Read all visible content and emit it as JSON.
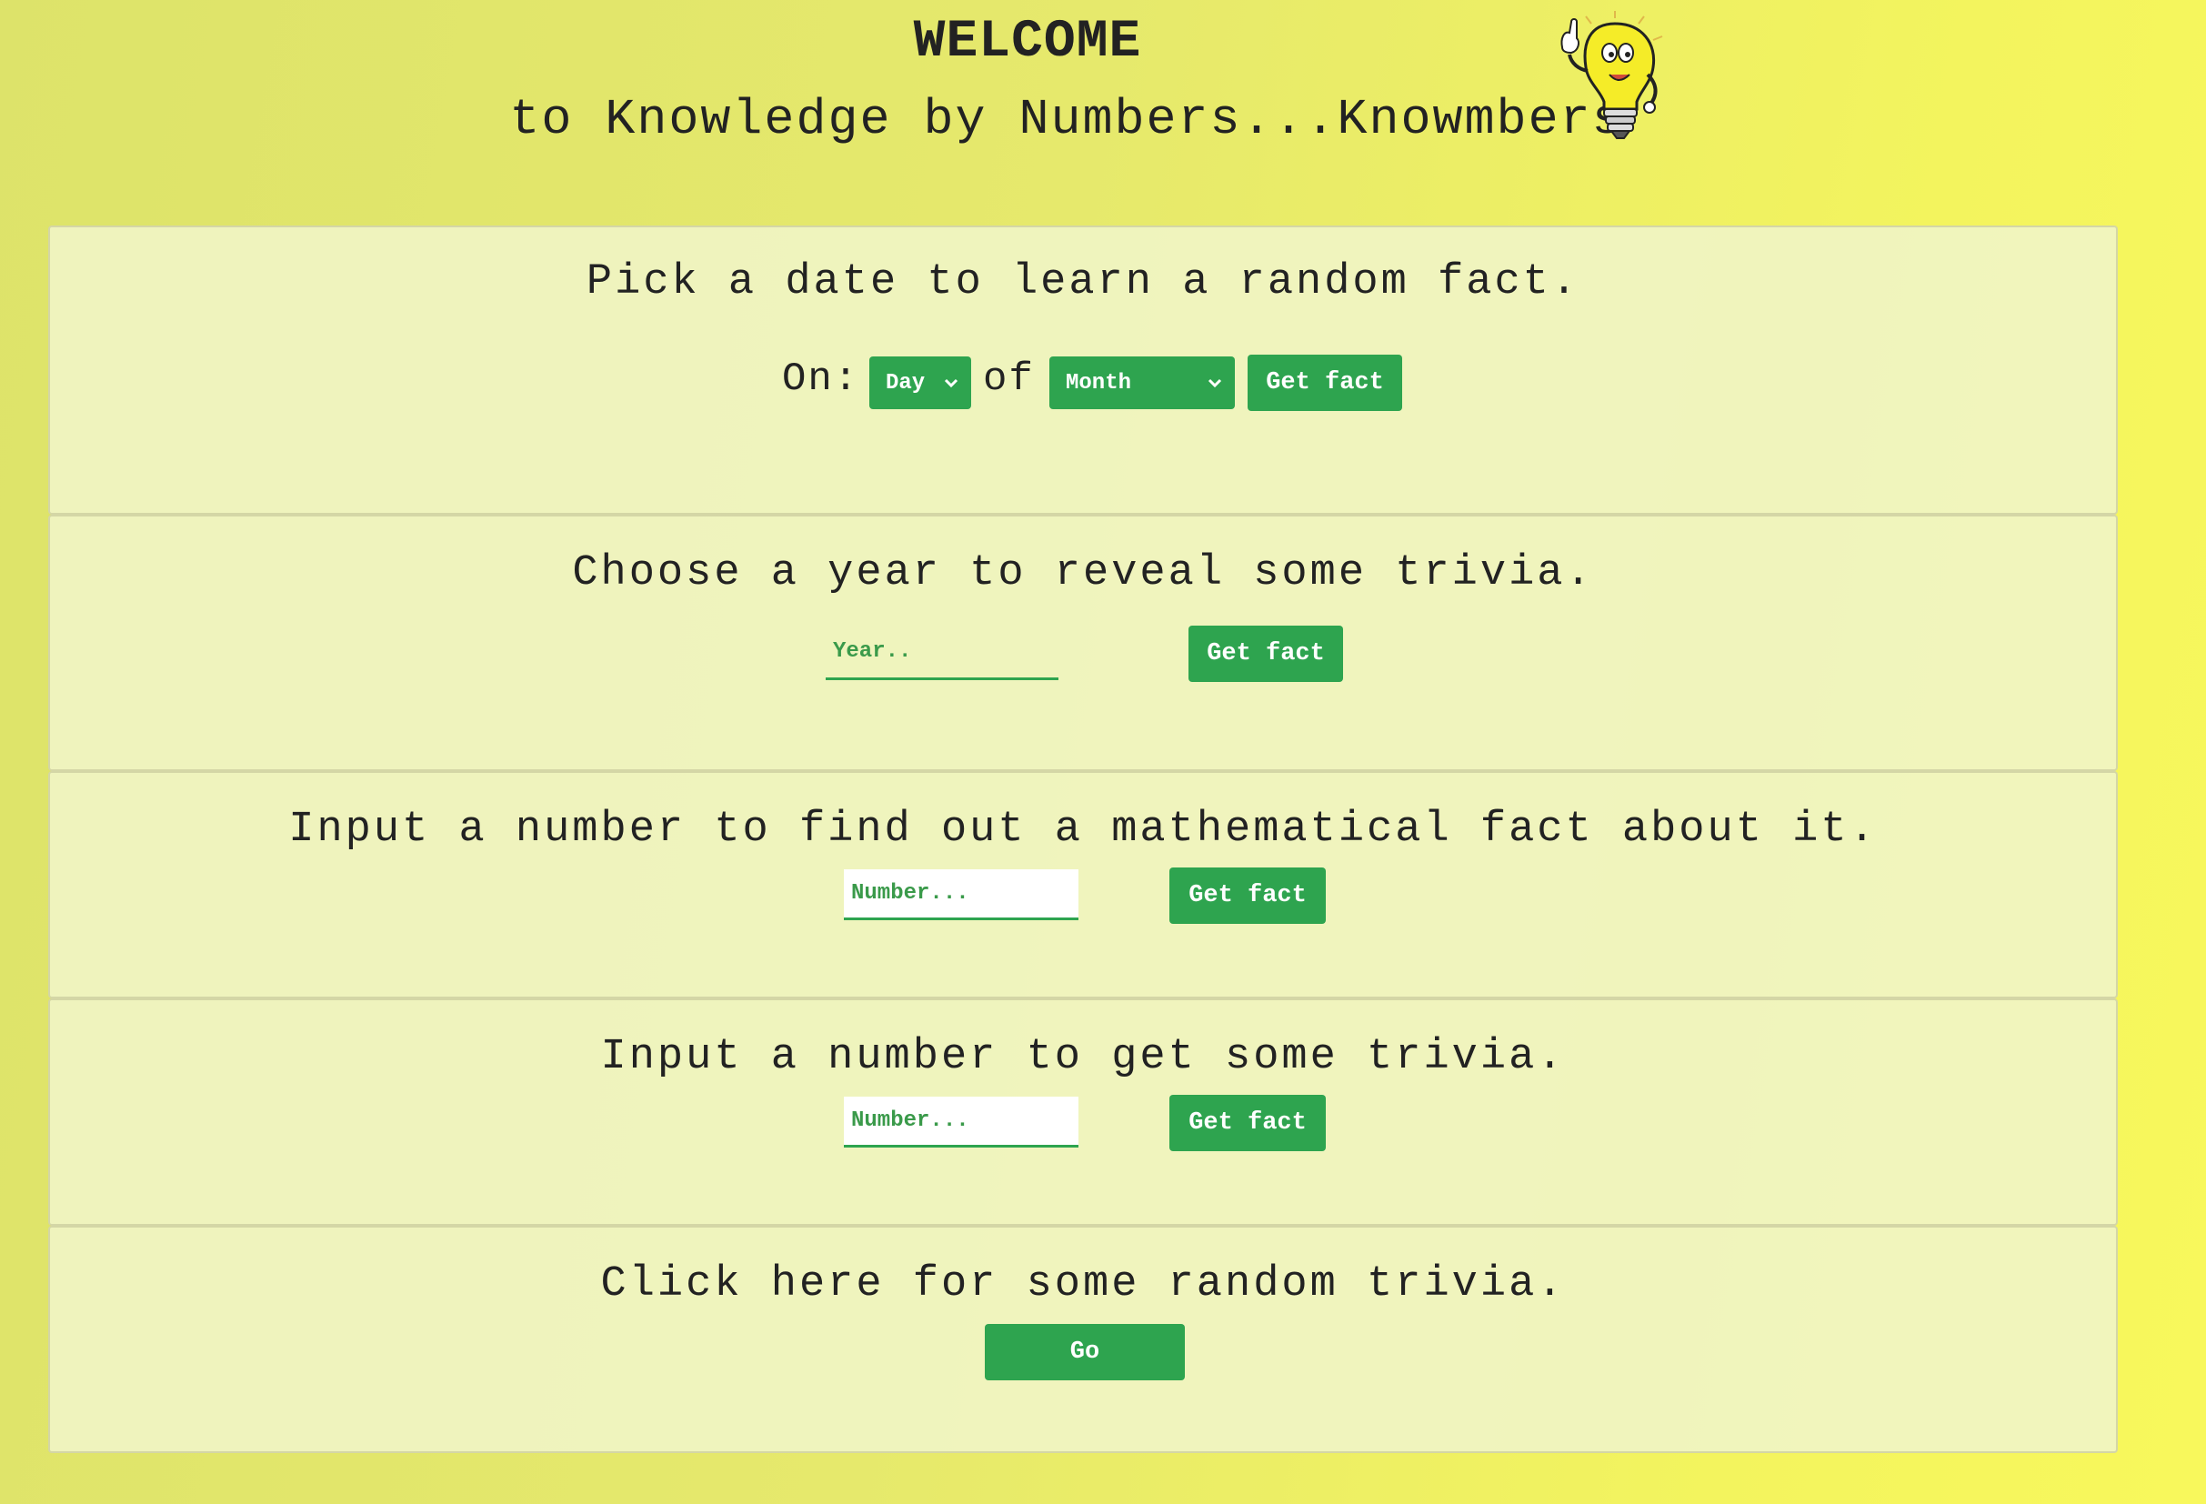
{
  "header": {
    "welcome": "WELCOME",
    "subtitle": "to Knowledge by Numbers...Knowmbers",
    "mascot_icon": "lightbulb-mascot-icon"
  },
  "date_section": {
    "title": "Pick a date to learn a random fact.",
    "on_label": "On:",
    "of_label": "of",
    "day_select": "Day",
    "month_select": "Month",
    "button": "Get fact"
  },
  "year_section": {
    "title": "Choose a year to reveal some trivia.",
    "placeholder": "Year..",
    "button": "Get fact"
  },
  "math_section": {
    "title": "Input a number to find out a mathematical fact about it.",
    "placeholder": "Number...",
    "button": "Get fact"
  },
  "trivia_section": {
    "title": "Input a number to get some trivia.",
    "placeholder": "Number...",
    "button": "Get fact"
  },
  "random_section": {
    "title": "Click here for some random trivia.",
    "button": "Go"
  },
  "colors": {
    "accent": "#2ea44f",
    "card": "#f0f4c4",
    "background": "#e6e96c"
  }
}
